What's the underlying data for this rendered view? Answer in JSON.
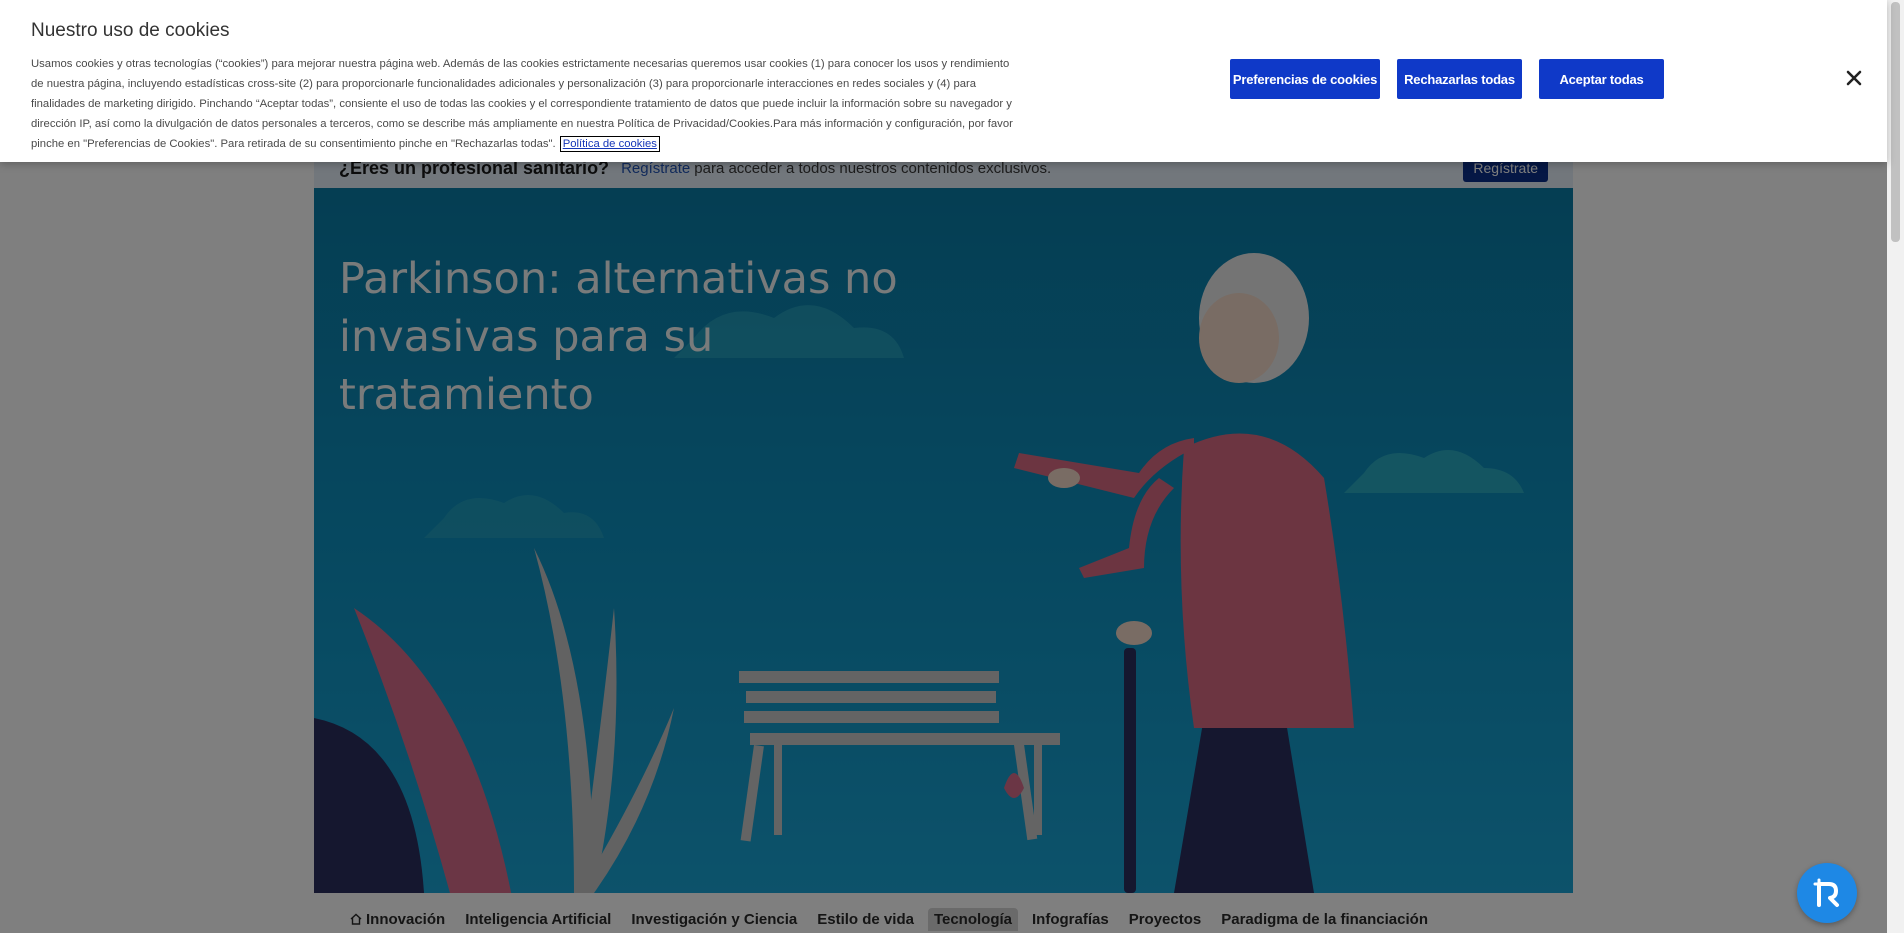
{
  "professional_bar": {
    "question": "¿Eres un profesional sanitario?",
    "link": "Regístrate",
    "rest": "para acceder a todos nuestros contenidos exclusivos.",
    "button": "Regístrate"
  },
  "hero": {
    "title": "Parkinson: alternativas no invasivas para su tratamiento"
  },
  "nav": {
    "items": [
      {
        "label": "Innovación",
        "icon": "home-icon"
      },
      {
        "label": "Inteligencia Artificial"
      },
      {
        "label": "Investigación y Ciencia"
      },
      {
        "label": "Estilo de vida"
      },
      {
        "label": "Tecnología",
        "active": true
      },
      {
        "label": "Infografías"
      },
      {
        "label": "Proyectos"
      },
      {
        "label": "Paradigma de la financiación"
      }
    ]
  },
  "cookies": {
    "title": "Nuestro uso de cookies",
    "body": "Usamos cookies y otras tecnologías (“cookies”) para mejorar nuestra página web. Además de las cookies estrictamente necesarias queremos usar cookies (1) para conocer los usos y rendimiento de nuestra página, incluyendo estadísticas cross-site (2) para proporcionarle funcionalidades adicionales y personalización (3) para proporcionarle interacciones en redes sociales y (4) para finalidades de marketing dirigido. Pinchando “Aceptar todas”, consiente el uso de todas las cookies y el correspondiente tratamiento de datos que puede incluir la información sobre su navegador y dirección IP, así como la divulgación de datos personales a terceros, como se describe más ampliamente en nuestra Política de Privacidad/Cookies.Para más información y configuración, por favor pinche en \"Preferencias de Cookies\". Para retirada de su consentimiento pinche en \"Rechazarlas todas\".",
    "policy_link": "Política de cookies",
    "buttons": {
      "preferences": "Preferencias de cookies",
      "reject": "Rechazarlas todas",
      "accept": "Aceptar todas"
    },
    "close_icon": "close-icon"
  },
  "widget": {
    "icon": "accessibility-widget-icon"
  },
  "colors": {
    "primary_button": "#0f39c8",
    "hero_bg": "#0c8fbe",
    "overlay": "rgba(0,0,0,0.5)"
  }
}
